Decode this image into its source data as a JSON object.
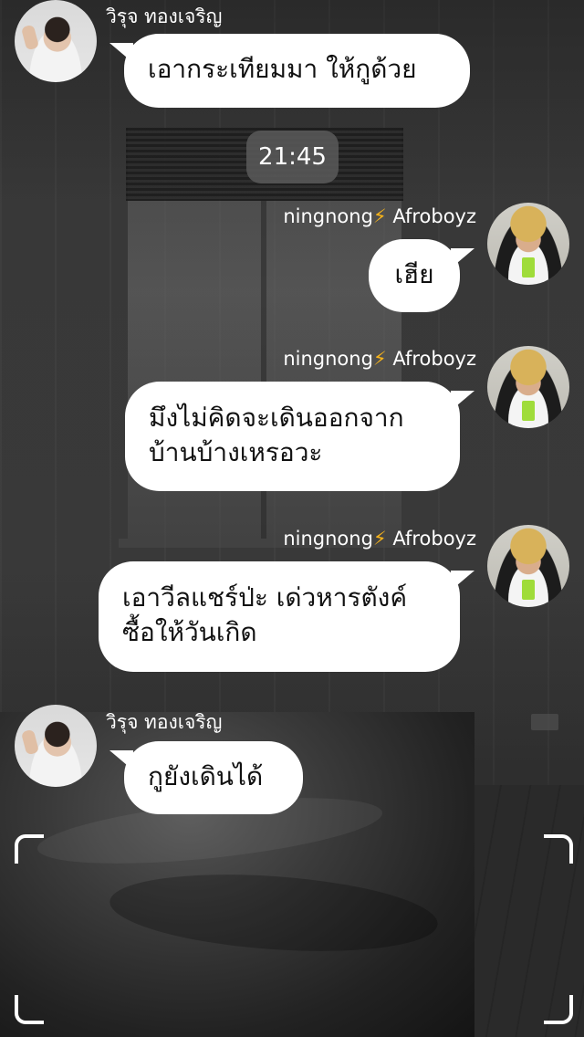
{
  "timestamp": "21:45",
  "participants": {
    "left": {
      "name": "วิรุจ ทองเจริญ"
    },
    "right": {
      "name_prefix": "ningnong",
      "name_bolt": "⚡",
      "name_suffix": " Afroboyz"
    }
  },
  "messages": [
    {
      "from": "left",
      "sender": "วิรุจ ทองเจริญ",
      "text": "เอากระเทียมมา ให้กูด้วย"
    },
    {
      "from": "right",
      "sender_prefix": "ningnong",
      "sender_suffix": " Afroboyz",
      "text": "เฮีย"
    },
    {
      "from": "right",
      "sender_prefix": "ningnong",
      "sender_suffix": " Afroboyz",
      "lines": [
        "มึงไม่คิดจะเดินออกจาก",
        "บ้านบ้างเหรอวะ"
      ]
    },
    {
      "from": "right",
      "sender_prefix": "ningnong",
      "sender_suffix": " Afroboyz",
      "lines": [
        "เอาวีลแชร์ป่ะ เด่วหารตังค์",
        "ซื้อให้วันเกิด"
      ]
    },
    {
      "from": "left",
      "sender": "วิรุจ ทองเจริญ",
      "text": "กูยังเดินได้"
    }
  ],
  "icons": {
    "bolt": "lightning-bolt-icon",
    "frame": "camera-frame-corners"
  },
  "colors": {
    "bubble": "#ffffff",
    "bubble_text": "#111111",
    "bolt": "#f5b21b",
    "time_pill": "#5a5a5a"
  }
}
